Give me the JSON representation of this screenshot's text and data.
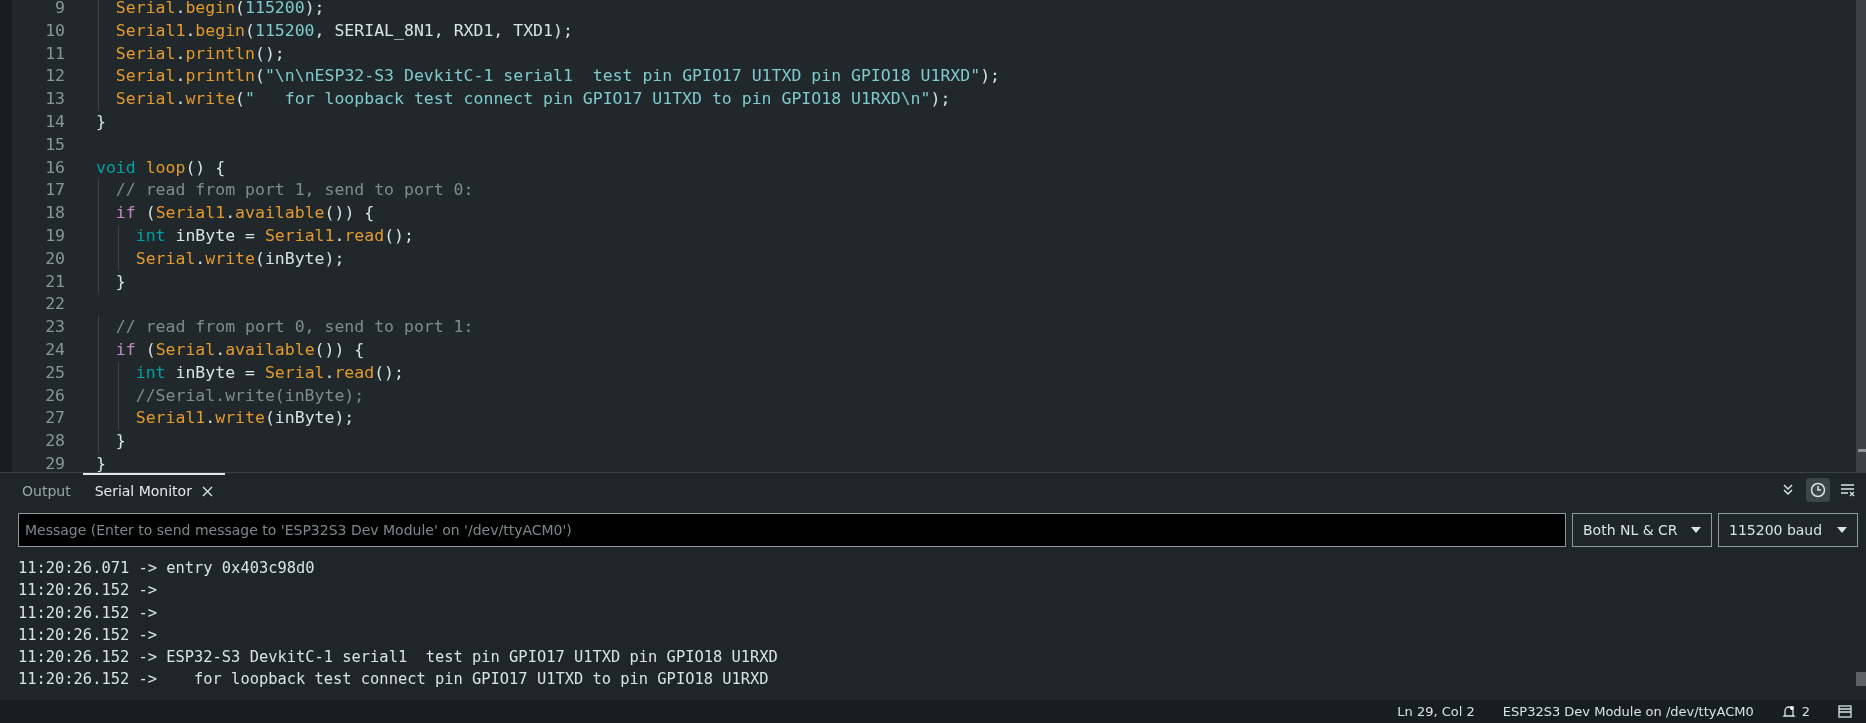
{
  "editor": {
    "lines": [
      {
        "number": "9",
        "tokens": [
          {
            "kind": "class",
            "text": "  Serial"
          },
          {
            "kind": "plain",
            "text": "."
          },
          {
            "kind": "class",
            "text": "begin"
          },
          {
            "kind": "plain",
            "text": "("
          },
          {
            "kind": "literal",
            "text": "115200"
          },
          {
            "kind": "plain",
            "text": ");"
          }
        ]
      },
      {
        "number": "10",
        "tokens": [
          {
            "kind": "class",
            "text": "  Serial1"
          },
          {
            "kind": "plain",
            "text": "."
          },
          {
            "kind": "class",
            "text": "begin"
          },
          {
            "kind": "plain",
            "text": "("
          },
          {
            "kind": "literal",
            "text": "115200"
          },
          {
            "kind": "plain",
            "text": ", SERIAL_8N1, RXD1, TXD1);"
          }
        ]
      },
      {
        "number": "11",
        "tokens": [
          {
            "kind": "class",
            "text": "  Serial"
          },
          {
            "kind": "plain",
            "text": "."
          },
          {
            "kind": "class",
            "text": "println"
          },
          {
            "kind": "plain",
            "text": "();"
          }
        ]
      },
      {
        "number": "12",
        "tokens": [
          {
            "kind": "class",
            "text": "  Serial"
          },
          {
            "kind": "plain",
            "text": "."
          },
          {
            "kind": "class",
            "text": "println"
          },
          {
            "kind": "plain",
            "text": "("
          },
          {
            "kind": "literal",
            "text": "\"\\n\\nESP32-S3 DevkitC-1 serial1  test pin GPIO17 U1TXD pin GPIO18 U1RXD\""
          },
          {
            "kind": "plain",
            "text": ");"
          }
        ]
      },
      {
        "number": "13",
        "tokens": [
          {
            "kind": "class",
            "text": "  Serial"
          },
          {
            "kind": "plain",
            "text": "."
          },
          {
            "kind": "class",
            "text": "write"
          },
          {
            "kind": "plain",
            "text": "("
          },
          {
            "kind": "literal",
            "text": "\"   for loopback test connect pin GPIO17 U1TXD to pin GPIO18 U1RXD\\n\""
          },
          {
            "kind": "plain",
            "text": ");"
          }
        ]
      },
      {
        "number": "14",
        "tokens": [
          {
            "kind": "plain",
            "text": "}"
          }
        ]
      },
      {
        "number": "15"
      },
      {
        "number": "16",
        "tokens": [
          {
            "kind": "type",
            "text": "void "
          },
          {
            "kind": "class",
            "text": "loop"
          },
          {
            "kind": "plain",
            "text": "() {"
          }
        ]
      },
      {
        "number": "17",
        "tokens": [
          {
            "kind": "comment",
            "text": "  // read from port 1, send to port 0:"
          }
        ]
      },
      {
        "number": "18",
        "tokens": [
          {
            "kind": "keyword",
            "text": "  if"
          },
          {
            "kind": "plain",
            "text": " ("
          },
          {
            "kind": "class",
            "text": "Serial1"
          },
          {
            "kind": "plain",
            "text": "."
          },
          {
            "kind": "class",
            "text": "available"
          },
          {
            "kind": "plain",
            "text": "()) {"
          }
        ]
      },
      {
        "number": "19",
        "tokens": [
          {
            "kind": "type",
            "text": "    int"
          },
          {
            "kind": "plain",
            "text": " inByte = "
          },
          {
            "kind": "class",
            "text": "Serial1"
          },
          {
            "kind": "plain",
            "text": "."
          },
          {
            "kind": "class",
            "text": "read"
          },
          {
            "kind": "plain",
            "text": "();"
          }
        ]
      },
      {
        "number": "20",
        "tokens": [
          {
            "kind": "class",
            "text": "    Serial"
          },
          {
            "kind": "plain",
            "text": "."
          },
          {
            "kind": "class",
            "text": "write"
          },
          {
            "kind": "plain",
            "text": "(inByte);"
          }
        ]
      },
      {
        "number": "21",
        "tokens": [
          {
            "kind": "plain",
            "text": "  }"
          }
        ]
      },
      {
        "number": "22"
      },
      {
        "number": "23",
        "tokens": [
          {
            "kind": "comment",
            "text": "  // read from port 0, send to port 1:"
          }
        ]
      },
      {
        "number": "24",
        "tokens": [
          {
            "kind": "keyword",
            "text": "  if"
          },
          {
            "kind": "plain",
            "text": " ("
          },
          {
            "kind": "class",
            "text": "Serial"
          },
          {
            "kind": "plain",
            "text": "."
          },
          {
            "kind": "class",
            "text": "available"
          },
          {
            "kind": "plain",
            "text": "()) {"
          }
        ]
      },
      {
        "number": "25",
        "tokens": [
          {
            "kind": "type",
            "text": "    int"
          },
          {
            "kind": "plain",
            "text": " inByte = "
          },
          {
            "kind": "class",
            "text": "Serial"
          },
          {
            "kind": "plain",
            "text": "."
          },
          {
            "kind": "class",
            "text": "read"
          },
          {
            "kind": "plain",
            "text": "();"
          }
        ]
      },
      {
        "number": "26",
        "tokens": [
          {
            "kind": "comment",
            "text": "    //Serial.write(inByte);"
          }
        ]
      },
      {
        "number": "27",
        "tokens": [
          {
            "kind": "class",
            "text": "    Serial1"
          },
          {
            "kind": "plain",
            "text": "."
          },
          {
            "kind": "class",
            "text": "write"
          },
          {
            "kind": "plain",
            "text": "(inByte);"
          }
        ]
      },
      {
        "number": "28",
        "tokens": [
          {
            "kind": "plain",
            "text": "  }"
          }
        ]
      },
      {
        "number": "29",
        "tokens": [
          {
            "kind": "plain",
            "text": "}"
          }
        ]
      }
    ]
  },
  "panel": {
    "tabs": [
      {
        "label": "Output",
        "selected": false
      },
      {
        "label": "Serial Monitor",
        "selected": true
      }
    ],
    "autoscroll": {
      "on": false
    },
    "timestamp": {
      "on": true
    },
    "message": {
      "placeholder": "Message (Enter to send message to 'ESP32S3 Dev Module' on '/dev/ttyACM0')"
    },
    "line_ending": "Both NL & CR",
    "baud": "115200 baud",
    "output": [
      "11:20:26.071 -> entry 0x403c98d0",
      "11:20:26.152 ->",
      "11:20:26.152 ->",
      "11:20:26.152 ->",
      "11:20:26.152 -> ESP32-S3 DevkitC-1 serial1  test pin GPIO17 U1TXD pin GPIO18 U1RXD",
      "11:20:26.152 ->    for loopback test connect pin GPIO17 U1TXD to pin GPIO18 U1RXD"
    ]
  },
  "status_bar": {
    "position": "Ln 29, Col 2",
    "board": "ESP32S3 Dev Module on /dev/ttyACM0",
    "notifications": "2"
  }
}
